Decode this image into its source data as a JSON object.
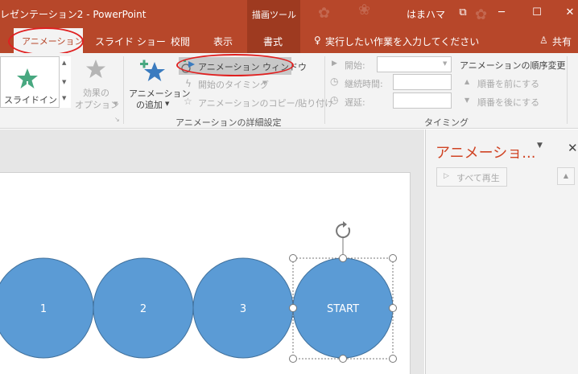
{
  "window": {
    "title": "レゼンテーション2 - PowerPoint",
    "contextual_group": "描画ツール",
    "user": "はまハマ",
    "buttons": {
      "restore": "⧉",
      "minimize": "─",
      "maximize": "☐",
      "close": "✕"
    }
  },
  "tabs": [
    {
      "label": "アニメーション",
      "active": true
    },
    {
      "label": "スライド ショー"
    },
    {
      "label": "校閲"
    },
    {
      "label": "表示"
    },
    {
      "label": "書式"
    }
  ],
  "tell_me": "実行したい作業を入力してください",
  "share": "共有",
  "ribbon": {
    "gallery_item": "スライドイン",
    "effect_options": [
      "効果の",
      "オプション"
    ],
    "add_animation": [
      "アニメーション",
      "の追加"
    ],
    "animation_pane": "アニメーション ウィンドウ",
    "trigger": "開始のタイミング",
    "painter": "アニメーションのコピー/貼り付け",
    "group_advanced": "アニメーションの詳細設定",
    "start_label": "開始:",
    "duration_label": "継続時間:",
    "delay_label": "遅延:",
    "group_timing": "タイミング",
    "reorder_title": "アニメーションの順序変更",
    "move_earlier": "順番を前にする",
    "move_later": "順番を後にする"
  },
  "pane": {
    "title": "アニメーショ...",
    "play_all": "すべて再生"
  },
  "slide": {
    "circles": [
      "1",
      "2",
      "3",
      "START"
    ]
  },
  "colors": {
    "accent": "#b7472a",
    "circle_fill": "#5b9bd5",
    "annotation": "#e02020"
  }
}
